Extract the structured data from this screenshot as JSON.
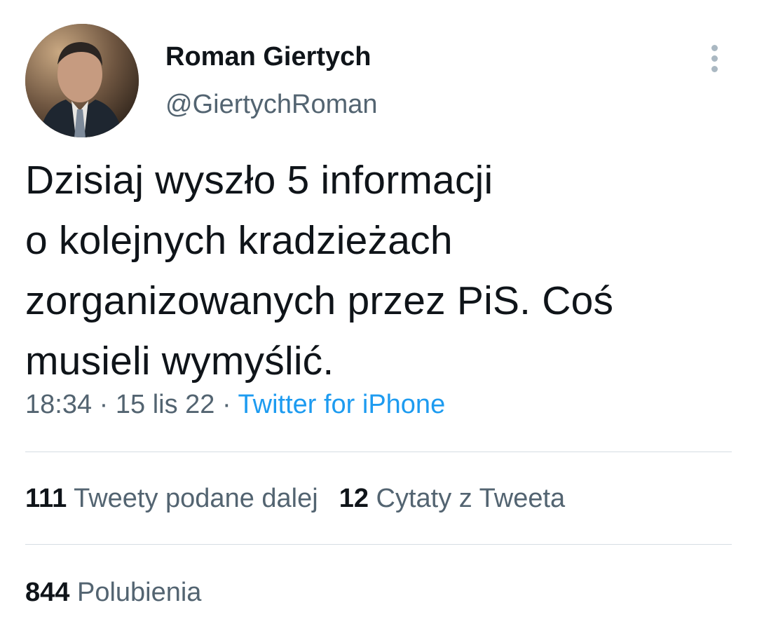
{
  "author": {
    "display_name": "Roman Giertych",
    "handle": "@GiertychRoman",
    "avatar_icon": "profile-photo"
  },
  "tweet": {
    "lines": [
      "Dzisiaj wyszło 5 informacji",
      "o kolejnych kradzieżach",
      "zorganizowanych przez PiS. Coś",
      "musieli wymyślić."
    ]
  },
  "meta": {
    "time": "18:34",
    "separator": "·",
    "date": "15 lis 22",
    "source": "Twitter for iPhone"
  },
  "stats": {
    "retweets_count": "111",
    "retweets_label": "Tweety podane dalej",
    "quotes_count": "12",
    "quotes_label": "Cytaty z Tweeta",
    "likes_count": "844",
    "likes_label": "Polubienia"
  },
  "colors": {
    "text": "#0f1419",
    "secondary": "#536471",
    "link": "#1d9bf0",
    "divider": "#d6dde3"
  },
  "icons": {
    "more": "more-vertical-icon"
  }
}
